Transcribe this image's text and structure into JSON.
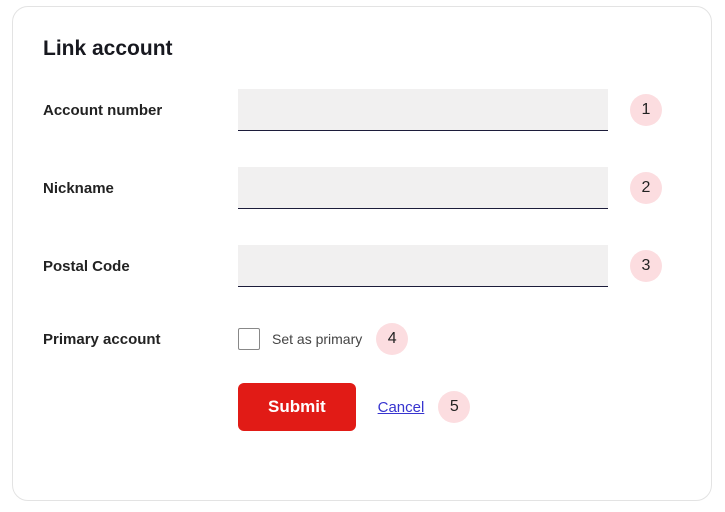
{
  "title": "Link account",
  "fields": {
    "accountNumber": {
      "label": "Account number",
      "value": "",
      "badge": "1"
    },
    "nickname": {
      "label": "Nickname",
      "value": "",
      "badge": "2"
    },
    "postalCode": {
      "label": "Postal Code",
      "value": "",
      "badge": "3"
    },
    "primary": {
      "label": "Primary account",
      "checkboxLabel": "Set as primary",
      "badge": "4"
    }
  },
  "actions": {
    "submit": "Submit",
    "cancel": "Cancel",
    "badge": "5"
  }
}
